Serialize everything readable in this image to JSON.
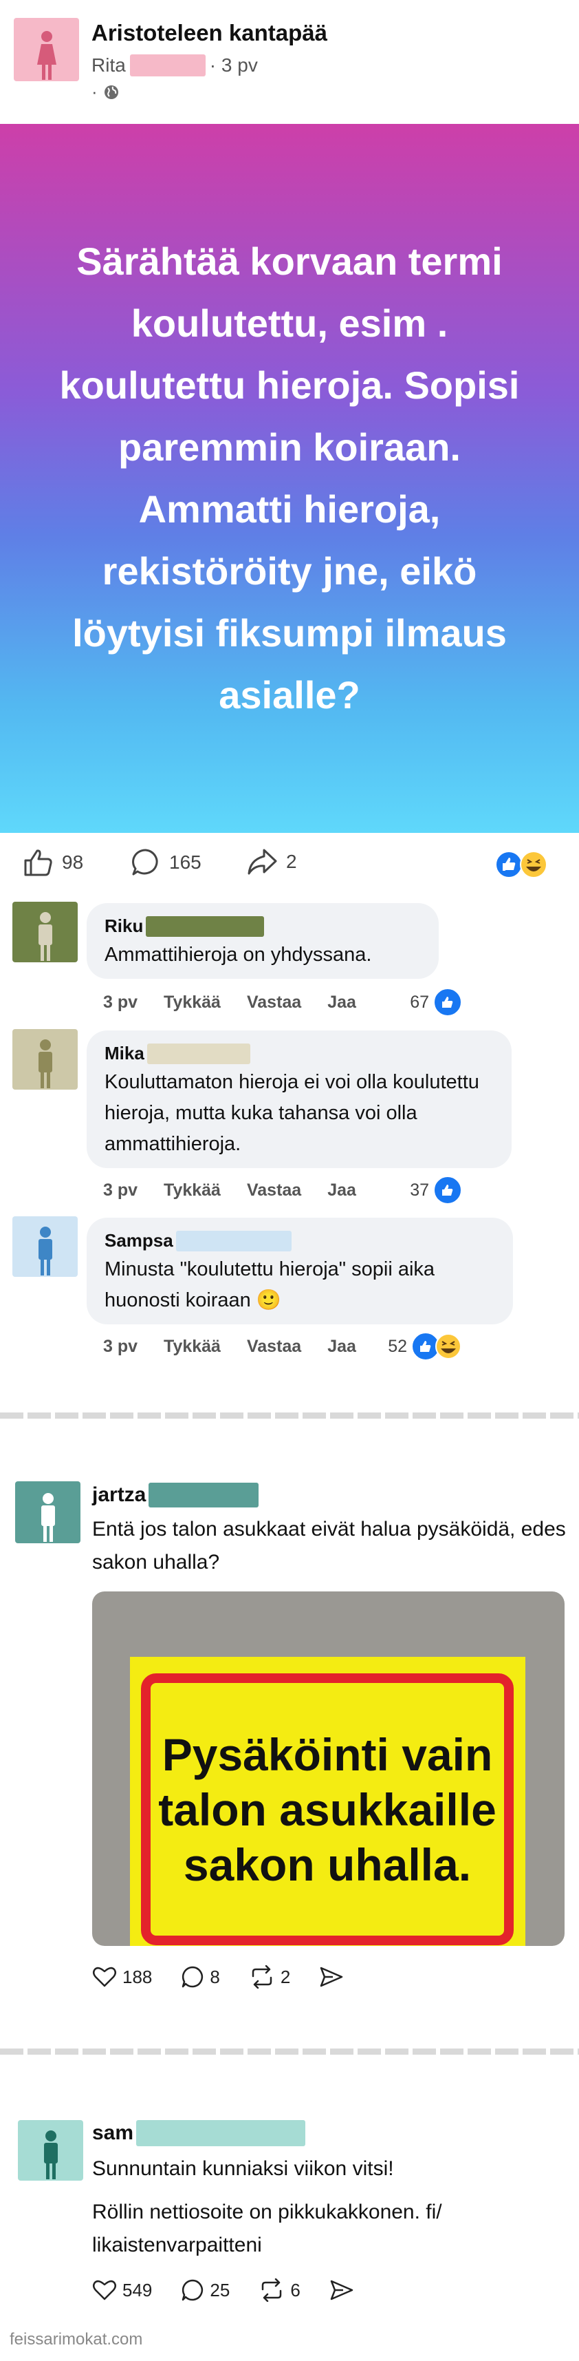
{
  "group": {
    "title": "Aristoteleen kantapää",
    "author": "Rita",
    "time": "· 3 pv",
    "privacy": "·"
  },
  "post": {
    "text": "Särähtää korvaan termi koulutettu, esim . koulutettu hieroja. Sopisi paremmin koiraan. Ammatti hieroja, rekistöröity jne, eikö löytyisi fiksumpi ilmaus asialle?",
    "likes": "98",
    "comments": "165",
    "shares": "2"
  },
  "comment_actions": {
    "time": "3 pv",
    "like": "Tykkää",
    "reply": "Vastaa",
    "share": "Jaa"
  },
  "comments": [
    {
      "name": "Riku",
      "text": "Ammattihieroja on yhdyssana.",
      "count": "67",
      "avatar_color": "#6f8246",
      "redact_color": "#6f8246"
    },
    {
      "name": "Mika",
      "text": "Kouluttamaton hieroja ei voi olla koulutettu hieroja, mutta kuka tahansa voi olla ammattihieroja.",
      "count": "37",
      "avatar_color": "#cdc8a8",
      "redact_color": "#e2dcc4"
    },
    {
      "name": "Sampsa",
      "text": "Minusta \"koulutettu hieroja\" sopii aika huonosti koiraan 🙂",
      "count": "52",
      "avatar_color": "#cfe4f4",
      "redact_color": "#cfe4f4"
    }
  ],
  "threads": [
    {
      "name": "jartza",
      "text": "Entä jos talon asukkaat eivät halua pysäköidä, edes sakon uhalla?",
      "likes": "188",
      "comments": "8",
      "reposts": "2",
      "avatar_color": "#5a9e96",
      "redact_color": "#5a9e96"
    },
    {
      "name": "sam",
      "text1": "Sunnuntain kunniaksi viikon vitsi!",
      "text2": "Röllin nettiosoite on pikkukakkonen. fi/ likaistenvarpaitteni",
      "likes": "549",
      "comments": "25",
      "reposts": "6",
      "avatar_color": "#a6dcd4",
      "redact_color": "#a6dcd4"
    }
  ],
  "sign": {
    "text": "Pysäköinti vain talon asukkaille sakon uhalla."
  },
  "watermark": "feissarimokat.com",
  "colors": {
    "facebook_blue": "#1877f2",
    "sign_yellow": "#f4ec12",
    "sign_red": "#e3232b"
  }
}
